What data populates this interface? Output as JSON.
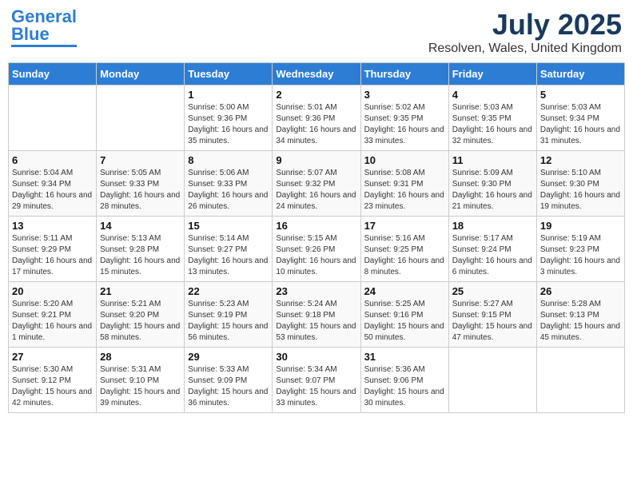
{
  "header": {
    "logo_general": "General",
    "logo_blue": "Blue",
    "month_year": "July 2025",
    "location": "Resolven, Wales, United Kingdom"
  },
  "weekdays": [
    "Sunday",
    "Monday",
    "Tuesday",
    "Wednesday",
    "Thursday",
    "Friday",
    "Saturday"
  ],
  "weeks": [
    [
      {
        "day": "",
        "sunrise": "",
        "sunset": "",
        "daylight": ""
      },
      {
        "day": "",
        "sunrise": "",
        "sunset": "",
        "daylight": ""
      },
      {
        "day": "1",
        "sunrise": "Sunrise: 5:00 AM",
        "sunset": "Sunset: 9:36 PM",
        "daylight": "Daylight: 16 hours and 35 minutes."
      },
      {
        "day": "2",
        "sunrise": "Sunrise: 5:01 AM",
        "sunset": "Sunset: 9:36 PM",
        "daylight": "Daylight: 16 hours and 34 minutes."
      },
      {
        "day": "3",
        "sunrise": "Sunrise: 5:02 AM",
        "sunset": "Sunset: 9:35 PM",
        "daylight": "Daylight: 16 hours and 33 minutes."
      },
      {
        "day": "4",
        "sunrise": "Sunrise: 5:03 AM",
        "sunset": "Sunset: 9:35 PM",
        "daylight": "Daylight: 16 hours and 32 minutes."
      },
      {
        "day": "5",
        "sunrise": "Sunrise: 5:03 AM",
        "sunset": "Sunset: 9:34 PM",
        "daylight": "Daylight: 16 hours and 31 minutes."
      }
    ],
    [
      {
        "day": "6",
        "sunrise": "Sunrise: 5:04 AM",
        "sunset": "Sunset: 9:34 PM",
        "daylight": "Daylight: 16 hours and 29 minutes."
      },
      {
        "day": "7",
        "sunrise": "Sunrise: 5:05 AM",
        "sunset": "Sunset: 9:33 PM",
        "daylight": "Daylight: 16 hours and 28 minutes."
      },
      {
        "day": "8",
        "sunrise": "Sunrise: 5:06 AM",
        "sunset": "Sunset: 9:33 PM",
        "daylight": "Daylight: 16 hours and 26 minutes."
      },
      {
        "day": "9",
        "sunrise": "Sunrise: 5:07 AM",
        "sunset": "Sunset: 9:32 PM",
        "daylight": "Daylight: 16 hours and 24 minutes."
      },
      {
        "day": "10",
        "sunrise": "Sunrise: 5:08 AM",
        "sunset": "Sunset: 9:31 PM",
        "daylight": "Daylight: 16 hours and 23 minutes."
      },
      {
        "day": "11",
        "sunrise": "Sunrise: 5:09 AM",
        "sunset": "Sunset: 9:30 PM",
        "daylight": "Daylight: 16 hours and 21 minutes."
      },
      {
        "day": "12",
        "sunrise": "Sunrise: 5:10 AM",
        "sunset": "Sunset: 9:30 PM",
        "daylight": "Daylight: 16 hours and 19 minutes."
      }
    ],
    [
      {
        "day": "13",
        "sunrise": "Sunrise: 5:11 AM",
        "sunset": "Sunset: 9:29 PM",
        "daylight": "Daylight: 16 hours and 17 minutes."
      },
      {
        "day": "14",
        "sunrise": "Sunrise: 5:13 AM",
        "sunset": "Sunset: 9:28 PM",
        "daylight": "Daylight: 16 hours and 15 minutes."
      },
      {
        "day": "15",
        "sunrise": "Sunrise: 5:14 AM",
        "sunset": "Sunset: 9:27 PM",
        "daylight": "Daylight: 16 hours and 13 minutes."
      },
      {
        "day": "16",
        "sunrise": "Sunrise: 5:15 AM",
        "sunset": "Sunset: 9:26 PM",
        "daylight": "Daylight: 16 hours and 10 minutes."
      },
      {
        "day": "17",
        "sunrise": "Sunrise: 5:16 AM",
        "sunset": "Sunset: 9:25 PM",
        "daylight": "Daylight: 16 hours and 8 minutes."
      },
      {
        "day": "18",
        "sunrise": "Sunrise: 5:17 AM",
        "sunset": "Sunset: 9:24 PM",
        "daylight": "Daylight: 16 hours and 6 minutes."
      },
      {
        "day": "19",
        "sunrise": "Sunrise: 5:19 AM",
        "sunset": "Sunset: 9:23 PM",
        "daylight": "Daylight: 16 hours and 3 minutes."
      }
    ],
    [
      {
        "day": "20",
        "sunrise": "Sunrise: 5:20 AM",
        "sunset": "Sunset: 9:21 PM",
        "daylight": "Daylight: 16 hours and 1 minute."
      },
      {
        "day": "21",
        "sunrise": "Sunrise: 5:21 AM",
        "sunset": "Sunset: 9:20 PM",
        "daylight": "Daylight: 15 hours and 58 minutes."
      },
      {
        "day": "22",
        "sunrise": "Sunrise: 5:23 AM",
        "sunset": "Sunset: 9:19 PM",
        "daylight": "Daylight: 15 hours and 56 minutes."
      },
      {
        "day": "23",
        "sunrise": "Sunrise: 5:24 AM",
        "sunset": "Sunset: 9:18 PM",
        "daylight": "Daylight: 15 hours and 53 minutes."
      },
      {
        "day": "24",
        "sunrise": "Sunrise: 5:25 AM",
        "sunset": "Sunset: 9:16 PM",
        "daylight": "Daylight: 15 hours and 50 minutes."
      },
      {
        "day": "25",
        "sunrise": "Sunrise: 5:27 AM",
        "sunset": "Sunset: 9:15 PM",
        "daylight": "Daylight: 15 hours and 47 minutes."
      },
      {
        "day": "26",
        "sunrise": "Sunrise: 5:28 AM",
        "sunset": "Sunset: 9:13 PM",
        "daylight": "Daylight: 15 hours and 45 minutes."
      }
    ],
    [
      {
        "day": "27",
        "sunrise": "Sunrise: 5:30 AM",
        "sunset": "Sunset: 9:12 PM",
        "daylight": "Daylight: 15 hours and 42 minutes."
      },
      {
        "day": "28",
        "sunrise": "Sunrise: 5:31 AM",
        "sunset": "Sunset: 9:10 PM",
        "daylight": "Daylight: 15 hours and 39 minutes."
      },
      {
        "day": "29",
        "sunrise": "Sunrise: 5:33 AM",
        "sunset": "Sunset: 9:09 PM",
        "daylight": "Daylight: 15 hours and 36 minutes."
      },
      {
        "day": "30",
        "sunrise": "Sunrise: 5:34 AM",
        "sunset": "Sunset: 9:07 PM",
        "daylight": "Daylight: 15 hours and 33 minutes."
      },
      {
        "day": "31",
        "sunrise": "Sunrise: 5:36 AM",
        "sunset": "Sunset: 9:06 PM",
        "daylight": "Daylight: 15 hours and 30 minutes."
      },
      {
        "day": "",
        "sunrise": "",
        "sunset": "",
        "daylight": ""
      },
      {
        "day": "",
        "sunrise": "",
        "sunset": "",
        "daylight": ""
      }
    ]
  ]
}
